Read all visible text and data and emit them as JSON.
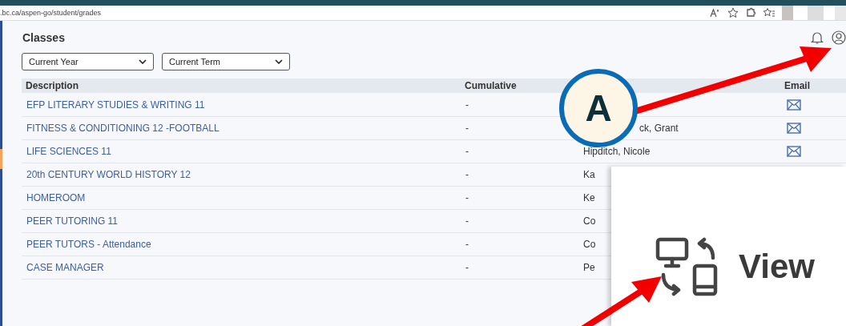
{
  "browser": {
    "url": ".bc.ca/aspen-go/student/grades"
  },
  "page": {
    "title": "Classes",
    "filters": [
      {
        "value": "Current Year"
      },
      {
        "value": "Current Term"
      }
    ]
  },
  "table": {
    "columns": [
      {
        "label": "Description"
      },
      {
        "label": "Cumulative"
      },
      {
        "label": "Email"
      }
    ],
    "rows": [
      {
        "description": "EFP LITERARY STUDIES & WRITING 11",
        "cumulative": "-",
        "email": true
      },
      {
        "description": "FITNESS & CONDITIONING 12 -FOOTBALL",
        "cumulative": "-",
        "column_3": "ck, Grant",
        "email": true
      },
      {
        "description": "LIFE SCIENCES 11",
        "cumulative": "-",
        "column_3": "Hipditch, Nicole",
        "email": true
      },
      {
        "description": "20th CENTURY WORLD HISTORY 12",
        "cumulative": "-",
        "column_3": "Ka"
      },
      {
        "description": "HOMEROOM",
        "cumulative": "-",
        "column_3": "Ke"
      },
      {
        "description": "PEER TUTORING 11",
        "cumulative": "-",
        "column_3": "Co"
      },
      {
        "description": "PEER TUTORS - Attendance",
        "cumulative": "-",
        "column_3": "Co"
      },
      {
        "description": "CASE MANAGER",
        "cumulative": "-",
        "column_3": "Pe"
      }
    ]
  },
  "callout": {
    "label": "A"
  },
  "popup": {
    "title": "View"
  }
}
